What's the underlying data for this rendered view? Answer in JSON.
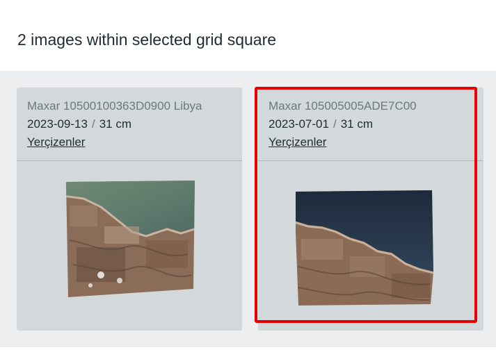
{
  "header": {
    "title": "2 images within selected grid square"
  },
  "cards": [
    {
      "title": "Maxar 10500100363D0900 Libya",
      "date": "2023-09-13",
      "separator": "/",
      "resolution": "31 cm",
      "link": "Yerçizenler",
      "thumbnail_icon": "satellite-image-thumbnail",
      "selected": false
    },
    {
      "title": "Maxar 105005005ADE7C00",
      "date": "2023-07-01",
      "separator": "/",
      "resolution": "31 cm",
      "link": "Yerçizenler",
      "thumbnail_icon": "satellite-image-thumbnail",
      "selected": true
    }
  ],
  "colors": {
    "selection_outline": "#e60000",
    "card_bg": "#d3d8da",
    "area_bg": "#eceeef"
  }
}
